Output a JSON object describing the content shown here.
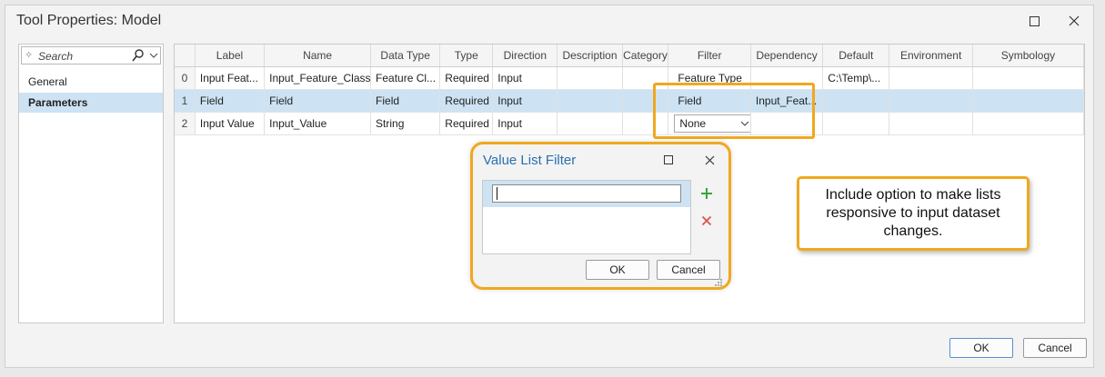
{
  "window": {
    "title": "Tool Properties: Model"
  },
  "sidebar": {
    "search_placeholder": "Search",
    "items": [
      {
        "label": "General",
        "selected": false
      },
      {
        "label": "Parameters",
        "selected": true
      }
    ]
  },
  "grid": {
    "columns": [
      "",
      "Label",
      "Name",
      "Data Type",
      "Type",
      "Direction",
      "Description",
      "Category",
      "Filter",
      "Dependency",
      "Default",
      "Environment",
      "Symbology"
    ],
    "rows": [
      {
        "index": "0",
        "label": "Input Feat...",
        "name": "Input_Feature_Class",
        "data_type": "Feature Cl...",
        "type": "Required",
        "direction": "Input",
        "description": "",
        "category": "",
        "filter": "Feature Type",
        "dependency": "",
        "default": "C:\\Temp\\...",
        "environment": "",
        "symbology": ""
      },
      {
        "index": "1",
        "label": "Field",
        "name": "Field",
        "data_type": "Field",
        "type": "Required",
        "direction": "Input",
        "description": "",
        "category": "",
        "filter": "Field",
        "dependency": "Input_Feat...",
        "default": "",
        "environment": "",
        "symbology": ""
      },
      {
        "index": "2",
        "label": "Input Value",
        "name": "Input_Value",
        "data_type": "String",
        "type": "Required",
        "direction": "Input",
        "description": "",
        "category": "",
        "filter": "None",
        "dependency": "",
        "default": "",
        "environment": "",
        "symbology": ""
      }
    ]
  },
  "dialog": {
    "title": "Value List Filter",
    "value": "",
    "ok_label": "OK",
    "cancel_label": "Cancel"
  },
  "callout": {
    "text": "Include option to make lists responsive to input dataset changes."
  },
  "footer": {
    "ok_label": "OK",
    "cancel_label": "Cancel"
  },
  "colors": {
    "highlight": "#f0a81e",
    "selection": "#cde3f3",
    "dialog_title": "#2a6fb0",
    "add_icon": "#3aa63a",
    "remove_icon": "#d9534f"
  }
}
